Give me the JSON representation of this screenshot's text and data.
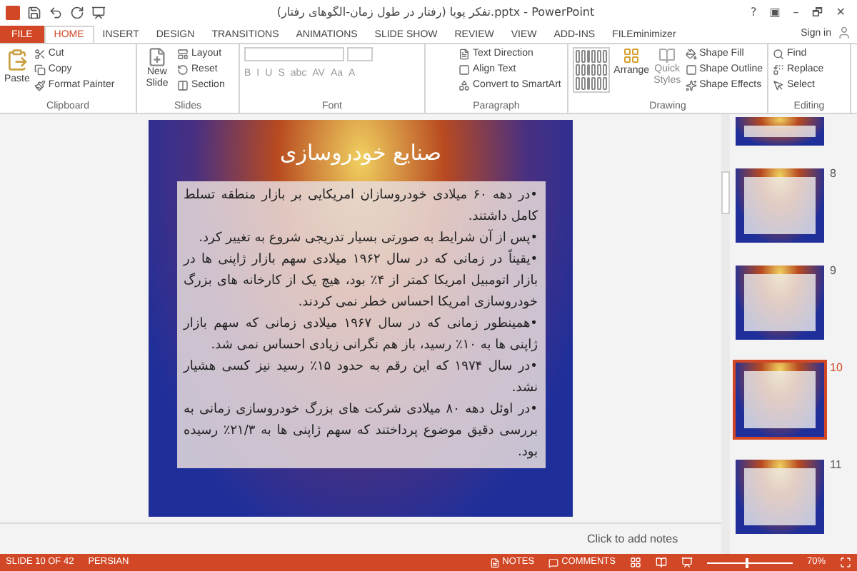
{
  "window": {
    "title": "تفکر پویا (رفتار در طول زمان-الگوهای رفتار).pptx - PowerPoint",
    "controls": [
      "?",
      "▣",
      "–",
      "🗗",
      "✕"
    ]
  },
  "tabs": [
    {
      "label": "FILE",
      "kind": "file",
      "selected": false
    },
    {
      "label": "HOME",
      "kind": "tab",
      "selected": true
    },
    {
      "label": "INSERT",
      "kind": "tab",
      "selected": false
    },
    {
      "label": "DESIGN",
      "kind": "tab",
      "selected": false
    },
    {
      "label": "TRANSITIONS",
      "kind": "tab",
      "selected": false
    },
    {
      "label": "ANIMATIONS",
      "kind": "tab",
      "selected": false
    },
    {
      "label": "SLIDE SHOW",
      "kind": "tab",
      "selected": false
    },
    {
      "label": "REVIEW",
      "kind": "tab",
      "selected": false
    },
    {
      "label": "VIEW",
      "kind": "tab",
      "selected": false
    },
    {
      "label": "ADD-INS",
      "kind": "tab",
      "selected": false
    },
    {
      "label": "FILEminimizer",
      "kind": "tab",
      "selected": false
    }
  ],
  "sign_in": "Sign in",
  "ribbon": {
    "clipboard": {
      "paste": "Paste",
      "items": [
        "Cut",
        "Copy",
        "Format Painter"
      ],
      "label": "Clipboard"
    },
    "slides": {
      "new_slide": "New Slide",
      "items": [
        "Layout",
        "Reset",
        "Section"
      ],
      "label": "Slides"
    },
    "font": {
      "label": "Font",
      "buttons": [
        "B",
        "I",
        "U",
        "S",
        "abc",
        "AV",
        "Aa",
        "A"
      ]
    },
    "paragraph": {
      "label": "Paragraph",
      "items": [
        "Text Direction",
        "Align Text",
        "Convert to SmartArt"
      ]
    },
    "drawing": {
      "label": "Drawing",
      "arrange": "Arrange",
      "quick_styles": "Quick Styles",
      "items": [
        "Shape Fill",
        "Shape Outline",
        "Shape Effects"
      ]
    },
    "editing": {
      "label": "Editing",
      "items": [
        "Find",
        "Replace",
        "Select"
      ]
    }
  },
  "slide": {
    "title": "صنایع خودروسازی",
    "bullets": [
      "•در دهه ۶۰ میلادی خودروسازان امریکایی بر بازار منطقه تسلط کامل داشتند.",
      "•پس از آن شرایط به صورتی بسیار تدریجی شروع به تغییر کرد.",
      "•یقیناً در زمانی که در سال ۱۹۶۲ میلادی سهم بازار ژاپنی ها در بازار اتومبیل امریکا کمتر از ۴٪ بود، هیچ یک از کارخانه های بزرگ خودروسازی امریکا احساس خطر نمی کردند.",
      "•همینطور زمانی که در سال ۱۹۶۷ میلادی زمانی که سهم بازار ژاپنی ها به ۱۰٪ رسید، باز هم نگرانی زیادی احساس نمی شد.",
      "•در سال ۱۹۷۴ که این رقم به حدود ۱۵٪ رسید نیز کسی هشیار نشد.",
      "•در اوئل دهه ۸۰ میلادی شرکت های بزرگ خودروسازی زمانی به بررسی دقیق موضوع پرداختند که سهم ژاپنی ها به ۲۱/۳٪ رسیده بود."
    ]
  },
  "notes": {
    "placeholder": "Click to add notes"
  },
  "thumbnails": [
    {
      "selected": false
    },
    {
      "number": "8",
      "selected": false
    },
    {
      "number": "9",
      "selected": false
    },
    {
      "number": "10",
      "selected": true
    },
    {
      "number": "11",
      "selected": false
    }
  ],
  "status_bar": {
    "slide": "SLIDE 10 OF 42",
    "language": "PERSIAN",
    "notes": "NOTES",
    "comments": "COMMENTS",
    "zoom": "70%",
    "level": 0.45
  }
}
